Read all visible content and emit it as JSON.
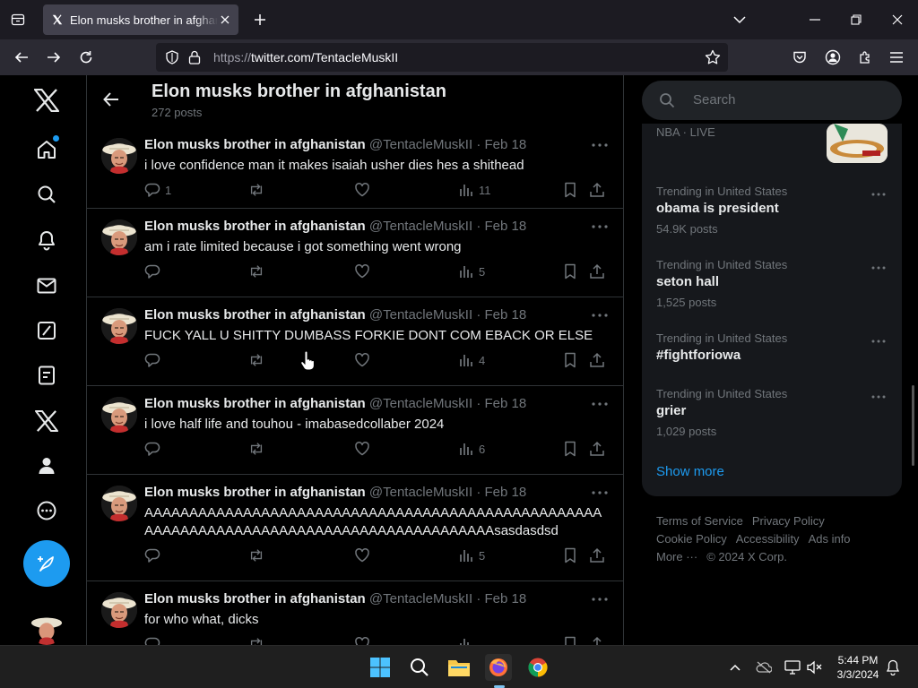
{
  "browser": {
    "tab_title": "Elon musks brother in afghanistan",
    "url_protocol": "https://",
    "url_rest": "twitter.com/TentacleMuskII"
  },
  "profile": {
    "name": "Elon musks brother in afghanistan",
    "post_count": "272 posts"
  },
  "tweets": [
    {
      "name": "Elon musks brother in afghanistan",
      "handle": "@TentacleMuskII",
      "date": "Feb 18",
      "text": "i love confidence man it makes isaiah usher dies hes a shithead",
      "replies": "1",
      "views": "11"
    },
    {
      "name": "Elon musks brother in afghanistan",
      "handle": "@TentacleMuskII",
      "date": "Feb 18",
      "text": "am i rate limited because i got something went wrong",
      "replies": "",
      "views": "5"
    },
    {
      "name": "Elon musks brother in afghanistan",
      "handle": "@TentacleMuskII",
      "date": "Feb 18",
      "text": "FUCK YALL U SHITTY DUMBASS FORKIE DONT COM EBACK OR  ELSE",
      "replies": "",
      "views": "4"
    },
    {
      "name": "Elon musks brother in afghanistan",
      "handle": "@TentacleMuskII",
      "date": "Feb 18",
      "text": "i love half life and touhou - imabasedcollaber 2024",
      "replies": "",
      "views": "6"
    },
    {
      "name": "Elon musks brother in afghanistan",
      "handle": "@TentacleMuskII",
      "date": "Feb 18",
      "text": "AAAAAAAAAAAAAAAAAAAAAAAAAAAAAAAAAAAAAAAAAAAAAAAAAAAAAAAAAAAAAAAAAAAAAAAAAAAAAAAAAAAAAAAAAAsasdasdsd",
      "replies": "",
      "views": "5"
    },
    {
      "name": "Elon musks brother in afghanistan",
      "handle": "@TentacleMuskII",
      "date": "Feb 18",
      "text": "for who what, dicks",
      "replies": "",
      "views": ""
    }
  ],
  "search": {
    "placeholder": "Search"
  },
  "trends": {
    "nba_label": "NBA · LIVE",
    "items": [
      {
        "context": "Trending in United States",
        "title": "obama is president",
        "count": "54.9K posts"
      },
      {
        "context": "Trending in United States",
        "title": "seton hall",
        "count": "1,525 posts"
      },
      {
        "context": "Trending in United States",
        "title": "#fightforiowa",
        "count": ""
      },
      {
        "context": "Trending in United States",
        "title": "grier",
        "count": "1,029 posts"
      }
    ],
    "show_more": "Show more"
  },
  "footer": {
    "terms": "Terms of Service",
    "privacy": "Privacy Policy",
    "cookie": "Cookie Policy",
    "accessibility": "Accessibility",
    "ads": "Ads info",
    "more": "More ···",
    "copyright": "© 2024 X Corp."
  },
  "taskbar": {
    "time": "5:44 PM",
    "date": "3/3/2024"
  },
  "colors": {
    "accent": "#1d9bf0",
    "muted": "#71767b",
    "text": "#e7e9ea",
    "border": "#2f3336"
  }
}
